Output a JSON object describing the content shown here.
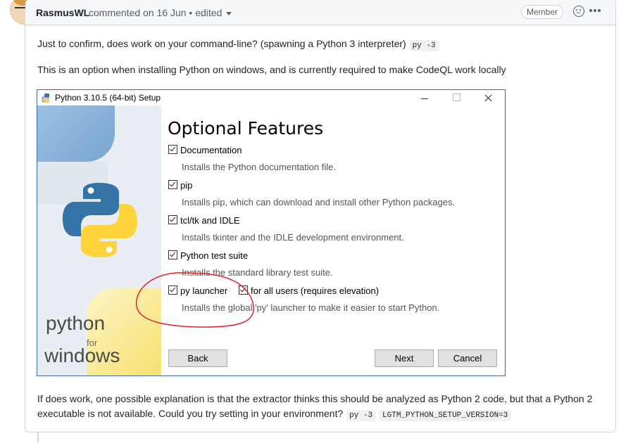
{
  "header": {
    "author": "RasmusWL",
    "meta": "commented on 16 Jun • edited",
    "badge": "Member"
  },
  "body": {
    "line1_text": "Just to confirm, does work on your command-line? (spawning a Python 3 interpreter)",
    "line1_code": "py -3",
    "line2_text": "This is an option when installing Python on windows, and is currently required to make CodeQL work locally",
    "footer_line1": "If does work, one possible explanation is that the extractor thinks this should be analyzed as Python 2 code, but that a Python 2",
    "footer_line2": "executable is not available. Could you try setting in your environment?",
    "footer_code1": "py -3",
    "footer_code2": "LGTM_PYTHON_SETUP_VERSION=3"
  },
  "installer": {
    "title": "Python 3.10.5 (64-bit) Setup",
    "heading": "Optional Features",
    "options": [
      {
        "label": "Documentation",
        "desc": "Installs the Python documentation file."
      },
      {
        "label": "pip",
        "desc": "Installs pip, which can download and install other Python packages."
      },
      {
        "label": "tcl/tk and IDLE",
        "desc": "Installs tkinter and the IDLE development environment."
      },
      {
        "label": "Python test suite",
        "desc": "Installs the standard library test suite."
      },
      {
        "label": "py launcher",
        "desc": "Installs the global 'py' launcher to make it easier to start Python."
      }
    ],
    "extra_option": "for all users (requires elevation)",
    "brand_python": "python",
    "brand_for": "for",
    "brand_windows": "windows",
    "buttons": {
      "back": "Back",
      "next": "Next",
      "cancel": "Cancel"
    }
  },
  "colors": {
    "annotation": "#e0252b",
    "accent": "#3a6ea5",
    "python_blue": "#3572a5",
    "python_yellow": "#ffd43b"
  }
}
